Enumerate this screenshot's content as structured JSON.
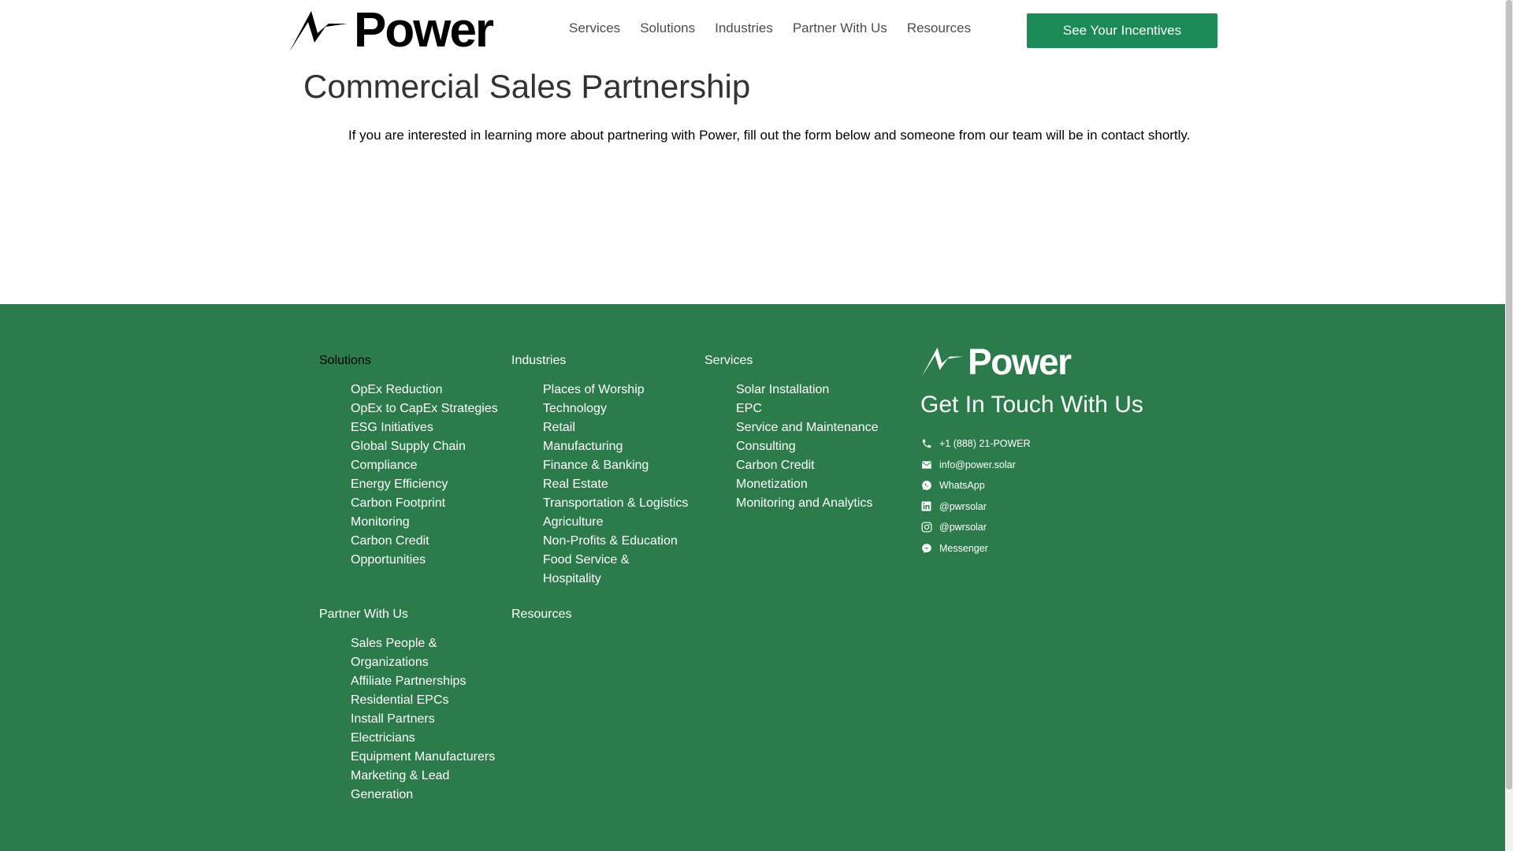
{
  "brand": {
    "name": "Power"
  },
  "nav": {
    "items": [
      {
        "label": "Services"
      },
      {
        "label": "Solutions"
      },
      {
        "label": "Industries"
      },
      {
        "label": "Partner With Us"
      },
      {
        "label": "Resources"
      }
    ],
    "cta_label": "See Your Incentives"
  },
  "main": {
    "title": "Commercial Sales Partnership",
    "intro": "If you are interested in learning more about partnering with Power, fill out the form below and someone from our team will be in contact shortly."
  },
  "footer": {
    "solutions": {
      "heading": "Solutions",
      "items": [
        "OpEx Reduction",
        "OpEx to CapEx Strategies",
        "ESG Initiatives",
        "Global Supply Chain Compliance",
        "Energy Efficiency",
        "Carbon Footprint Monitoring",
        "Carbon Credit Opportunities"
      ]
    },
    "industries": {
      "heading": "Industries",
      "items": [
        "Places of Worship",
        "Technology",
        "Retail",
        "Manufacturing",
        "Finance & Banking",
        "Real Estate",
        "Transportation & Logistics",
        "Agriculture",
        "Non-Profits & Education",
        "Food Service & Hospitality"
      ]
    },
    "services": {
      "heading": "Services",
      "items": [
        "Solar Installation",
        "EPC",
        "Service and Maintenance",
        "Consulting",
        "Carbon Credit Monetization",
        "Monitoring and Analytics"
      ]
    },
    "partner": {
      "heading": "Partner With Us",
      "items": [
        "Sales People & Organizations",
        "Affiliate Partnerships",
        "Residential EPCs",
        "Install Partners",
        "Electricians",
        "Equipment Manufacturers",
        "Marketing & Lead Generation"
      ]
    },
    "resources": {
      "heading": "Resources"
    },
    "contact": {
      "title": "Get In Touch With Us",
      "items": [
        {
          "icon": "phone-icon",
          "text": "+1 (888) 21-POWER"
        },
        {
          "icon": "envelope-icon",
          "text": "info@power.solar"
        },
        {
          "icon": "whatsapp-icon",
          "text": "WhatsApp"
        },
        {
          "icon": "linkedin-icon",
          "text": "@pwrsolar"
        },
        {
          "icon": "instagram-icon",
          "text": "@pwrsolar"
        },
        {
          "icon": "messenger-icon",
          "text": "Messenger"
        }
      ]
    }
  },
  "colors": {
    "brand_green": "#1b8a57",
    "footer_green": "#2b7b4b",
    "text_dark": "#333333",
    "nav_text": "#4d4d4d"
  }
}
